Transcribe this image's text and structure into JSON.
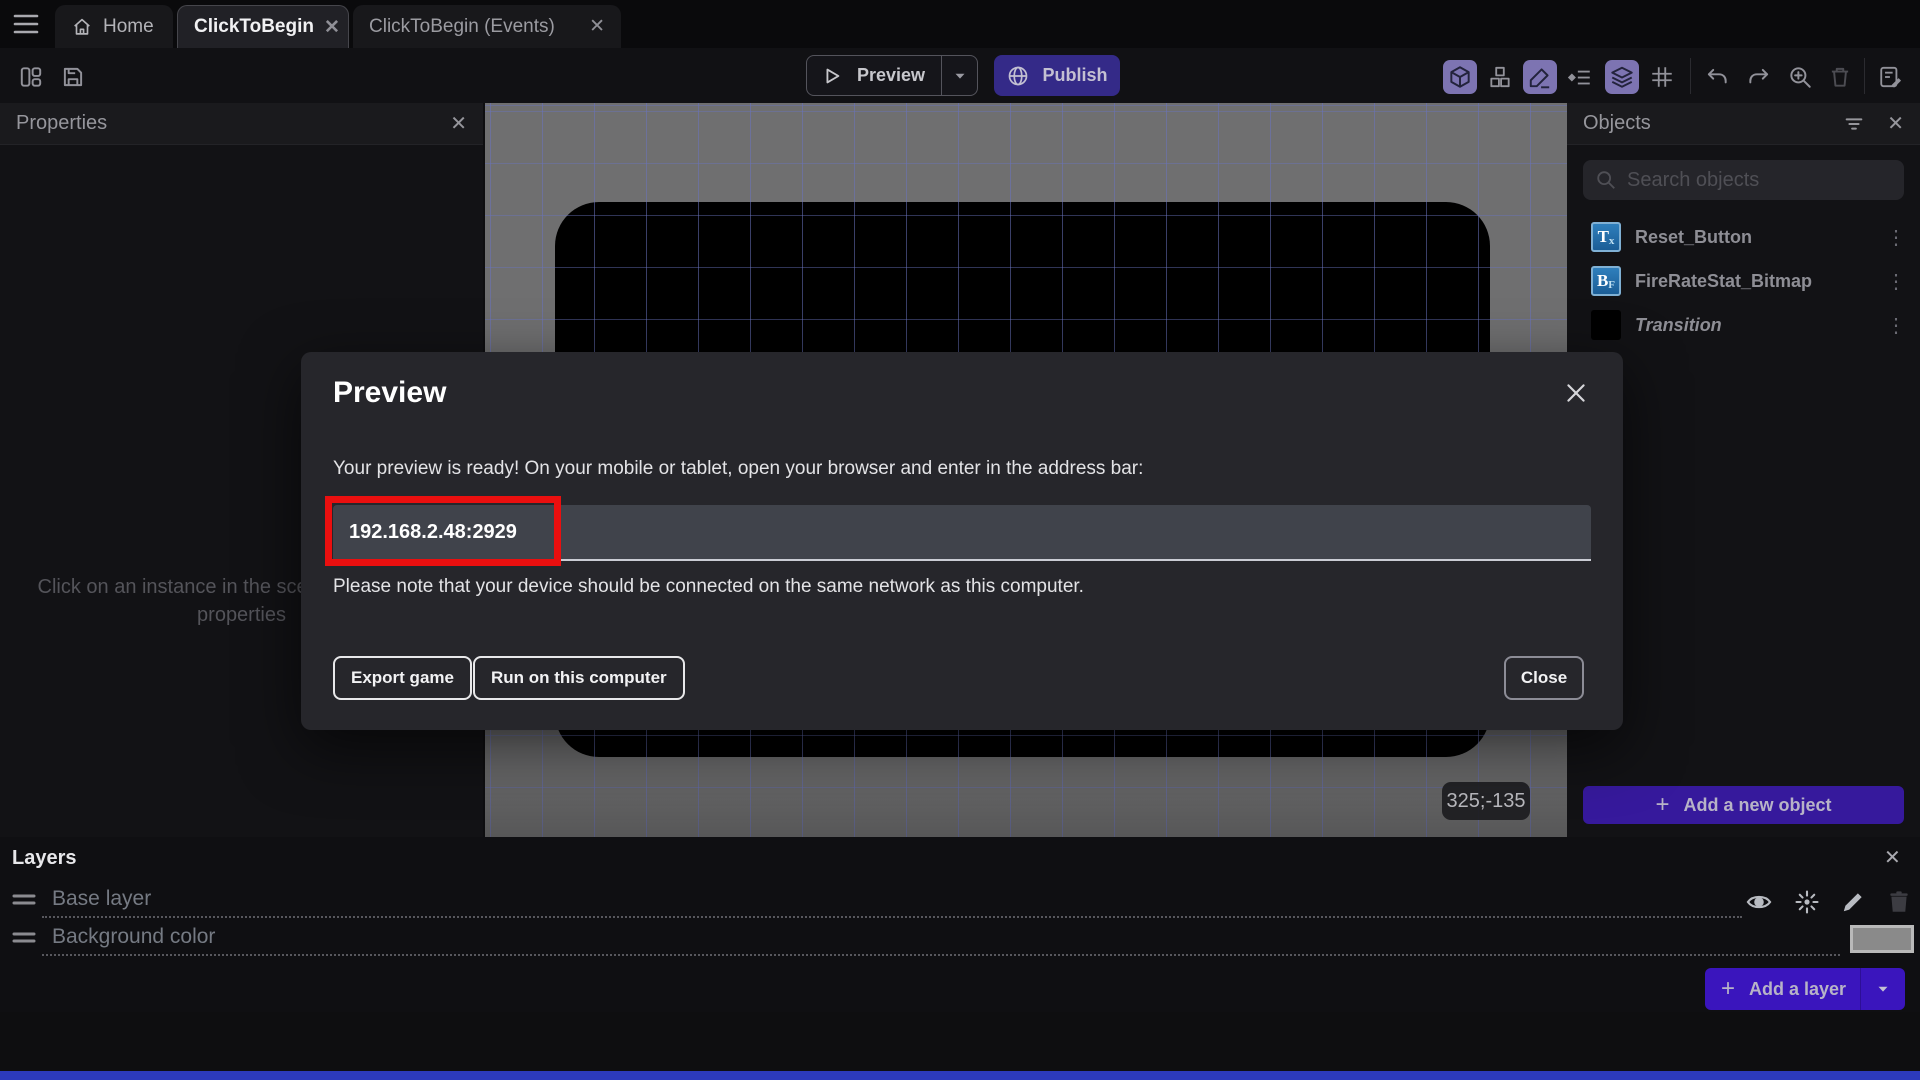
{
  "icons": {
    "close": "✕",
    "kebab": "⋮",
    "plus": "+"
  },
  "tab_bar": {
    "tabs": [
      {
        "label": "Home"
      },
      {
        "label": "ClickToBegin"
      },
      {
        "label": "ClickToBegin (Events)"
      }
    ]
  },
  "toolbar": {
    "preview_label": "Preview",
    "publish_label": "Publish"
  },
  "properties_panel": {
    "title": "Properties",
    "hint": "Click on an instance in the scene to display its properties"
  },
  "canvas": {
    "coords_badge": "325;-135"
  },
  "objects_panel": {
    "title": "Objects",
    "search_placeholder": "Search objects",
    "items": [
      {
        "name": "Reset_Button",
        "icon_big": "T",
        "icon_small": "x"
      },
      {
        "name": "FireRateStat_Bitmap",
        "icon_big": "B",
        "icon_small": "F"
      },
      {
        "name": "Transition"
      }
    ],
    "add_button_label": "Add a new object"
  },
  "modal": {
    "title": "Preview",
    "body": "Your preview is ready! On your mobile or tablet, open your browser and enter in the address bar:",
    "address": "192.168.2.48:2929",
    "note": "Please note that your device should be connected on the same network as this computer.",
    "buttons": {
      "export": "Export game",
      "run": "Run on this computer",
      "close": "Close"
    }
  },
  "layers_panel": {
    "title": "Layers",
    "rows": [
      {
        "name": "Base layer"
      },
      {
        "name": "Background color"
      }
    ],
    "add_button_label": "Add a layer"
  },
  "colors": {
    "publish_purple": "#342a88",
    "add_object_purple": "#36199c",
    "add_layer_purple": "#3a15bd",
    "toolbar_active_purple": "#7d74b2",
    "highlight_red": "#ea0f0f",
    "object_icon_blue": "#2a7ab8",
    "canvas_gray": "#6f6f70",
    "grid_blue": "#6973be"
  }
}
